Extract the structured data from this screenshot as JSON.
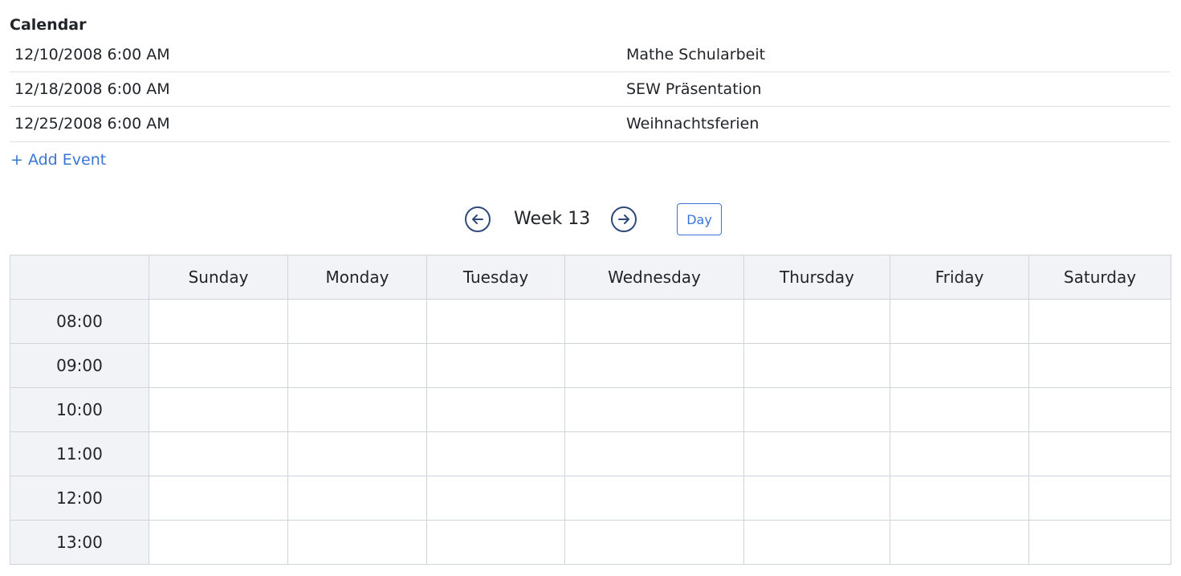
{
  "calendar": {
    "title": "Calendar",
    "events": [
      {
        "date": "12/10/2008 6:00 AM",
        "name": "Mathe Schularbeit"
      },
      {
        "date": "12/18/2008 6:00 AM",
        "name": "SEW Präsentation"
      },
      {
        "date": "12/25/2008 6:00 AM",
        "name": "Weihnachtsferien"
      }
    ],
    "add_event_label": "+ Add Event"
  },
  "week_nav": {
    "prev_icon": "arrow-left-circle-icon",
    "next_icon": "arrow-right-circle-icon",
    "week_label": "Week 13",
    "view_toggle_label": "Day"
  },
  "grid": {
    "days": [
      "Sunday",
      "Monday",
      "Tuesday",
      "Wednesday",
      "Thursday",
      "Friday",
      "Saturday"
    ],
    "times": [
      "08:00",
      "09:00",
      "10:00",
      "11:00",
      "12:00",
      "13:00"
    ]
  },
  "colors": {
    "accent": "#3a76d6",
    "header_bg": "#f1f3f7",
    "border": "#ced4da",
    "nav_icon": "#2f4a7a"
  }
}
